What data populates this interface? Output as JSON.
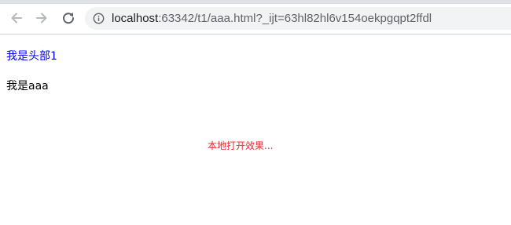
{
  "browser": {
    "url_host": "localhost",
    "url_rest": ":63342/t1/aaa.html?_ijt=63hl82hl6v154oekpgqpt2ffdl",
    "icons": {
      "back": "arrow-left-icon",
      "forward": "arrow-right-icon",
      "reload": "reload-icon",
      "info": "info-icon"
    }
  },
  "page": {
    "header_text": "我是头部1",
    "body_text": "我是aaa",
    "note_text": "本地打开效果..."
  },
  "colors": {
    "link": "#0000ee",
    "note": "#e8262c"
  }
}
